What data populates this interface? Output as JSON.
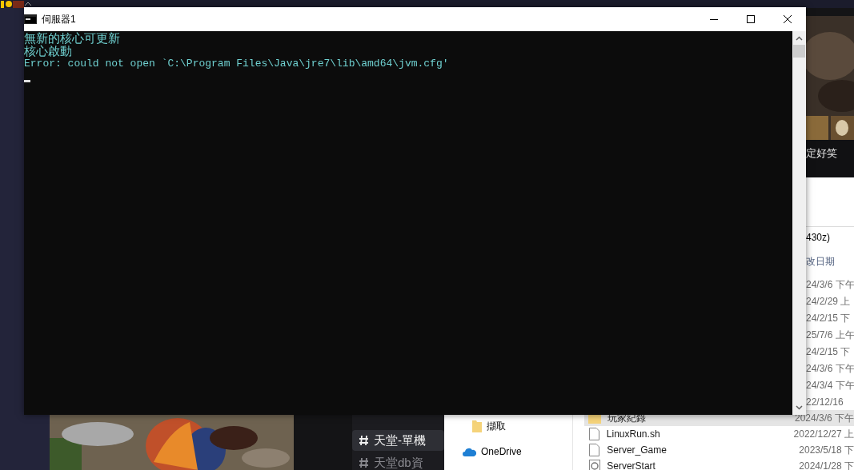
{
  "console": {
    "title": "伺服器1",
    "lines": [
      "無新的核心可更新",
      "核心啟動",
      "Error: could not open `C:\\Program Files\\Java\\jre7\\lib\\amd64\\jvm.cfg'"
    ]
  },
  "game_panel": {
    "caption": "定好笑"
  },
  "discord_channels": [
    {
      "label": "天堂-單機",
      "selected": true
    },
    {
      "label": "天堂db資",
      "selected": false
    }
  ],
  "explorer": {
    "path_fragment": "430z)",
    "column_header": "改日期",
    "dates": [
      "24/3/6 下午",
      "24/2/29 上",
      "24/2/15 下",
      "25/7/6 上午",
      "24/2/15 下",
      "24/3/6 下午",
      "24/3/4 下午",
      "22/12/16"
    ],
    "nav_items": [
      {
        "label": "擷取",
        "kind": "folder"
      },
      {
        "label": "OneDrive",
        "kind": "cloud"
      }
    ],
    "files": [
      {
        "name": "玩家紀錄",
        "kind": "folder",
        "date": "2024/3/6 下午",
        "selected": true
      },
      {
        "name": "LinuxRun.sh",
        "kind": "file",
        "date": "2022/12/27 上",
        "selected": false
      },
      {
        "name": "Server_Game",
        "kind": "file",
        "date": "2023/5/18 下",
        "selected": false
      },
      {
        "name": "ServerStart",
        "kind": "app",
        "date": "2024/1/28 下",
        "selected": false
      }
    ]
  }
}
